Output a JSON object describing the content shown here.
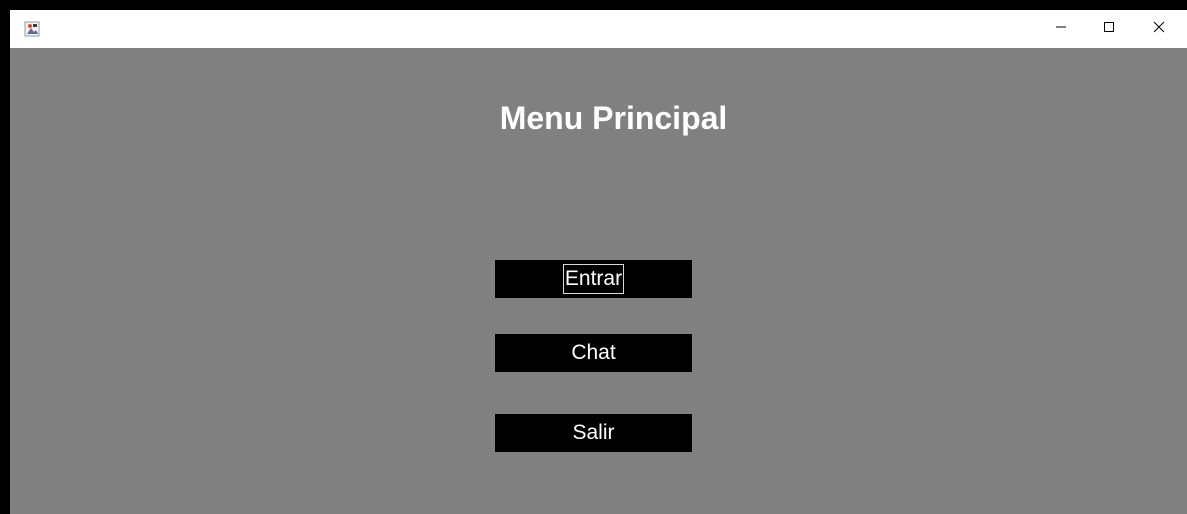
{
  "window": {
    "title": "",
    "controls": [
      "minimize-icon",
      "maximize-icon",
      "close-icon"
    ]
  },
  "main": {
    "heading": "Menu Principal",
    "buttons": {
      "enter": "Entrar",
      "chat": "Chat",
      "exit": "Salir"
    },
    "focused_button": "Entrar"
  },
  "colors": {
    "background": "#808080",
    "titlebar": "#ffffff",
    "button_bg": "#000000",
    "text": "#ffffff"
  }
}
